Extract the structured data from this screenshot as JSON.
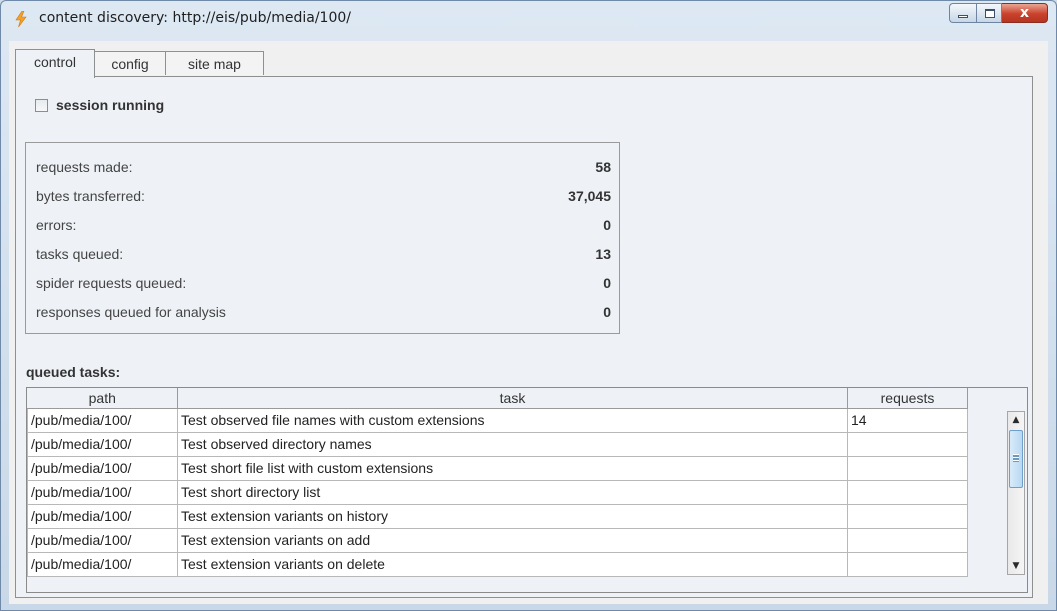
{
  "window": {
    "title": "content discovery: http://eis/pub/media/100/",
    "close_glyph": "x",
    "icon": "lightning-bolt-icon",
    "close_color": "#c9422c"
  },
  "tabs": [
    {
      "label": "control",
      "active": true
    },
    {
      "label": "config",
      "active": false
    },
    {
      "label": "site map",
      "active": false
    }
  ],
  "control": {
    "session_label": "session running",
    "session_checked": false,
    "stats": [
      {
        "label": "requests made:",
        "value": "58"
      },
      {
        "label": "bytes transferred:",
        "value": "37,045"
      },
      {
        "label": "errors:",
        "value": "0"
      },
      {
        "label": "tasks queued:",
        "value": "13"
      },
      {
        "label": "spider requests queued:",
        "value": "0"
      },
      {
        "label": "responses queued for analysis",
        "value": "0"
      }
    ],
    "queued_heading": "queued tasks:",
    "columns": [
      "path",
      "task",
      "requests"
    ],
    "rows": [
      {
        "path": "/pub/media/100/",
        "task": "Test observed file names with custom extensions",
        "requests": "14"
      },
      {
        "path": "/pub/media/100/",
        "task": "Test observed directory names",
        "requests": ""
      },
      {
        "path": "/pub/media/100/",
        "task": "Test short file list with custom extensions",
        "requests": ""
      },
      {
        "path": "/pub/media/100/",
        "task": "Test short directory list",
        "requests": ""
      },
      {
        "path": "/pub/media/100/",
        "task": "Test extension variants on history",
        "requests": ""
      },
      {
        "path": "/pub/media/100/",
        "task": "Test extension variants on add",
        "requests": ""
      },
      {
        "path": "/pub/media/100/",
        "task": "Test extension variants on delete",
        "requests": ""
      }
    ]
  }
}
